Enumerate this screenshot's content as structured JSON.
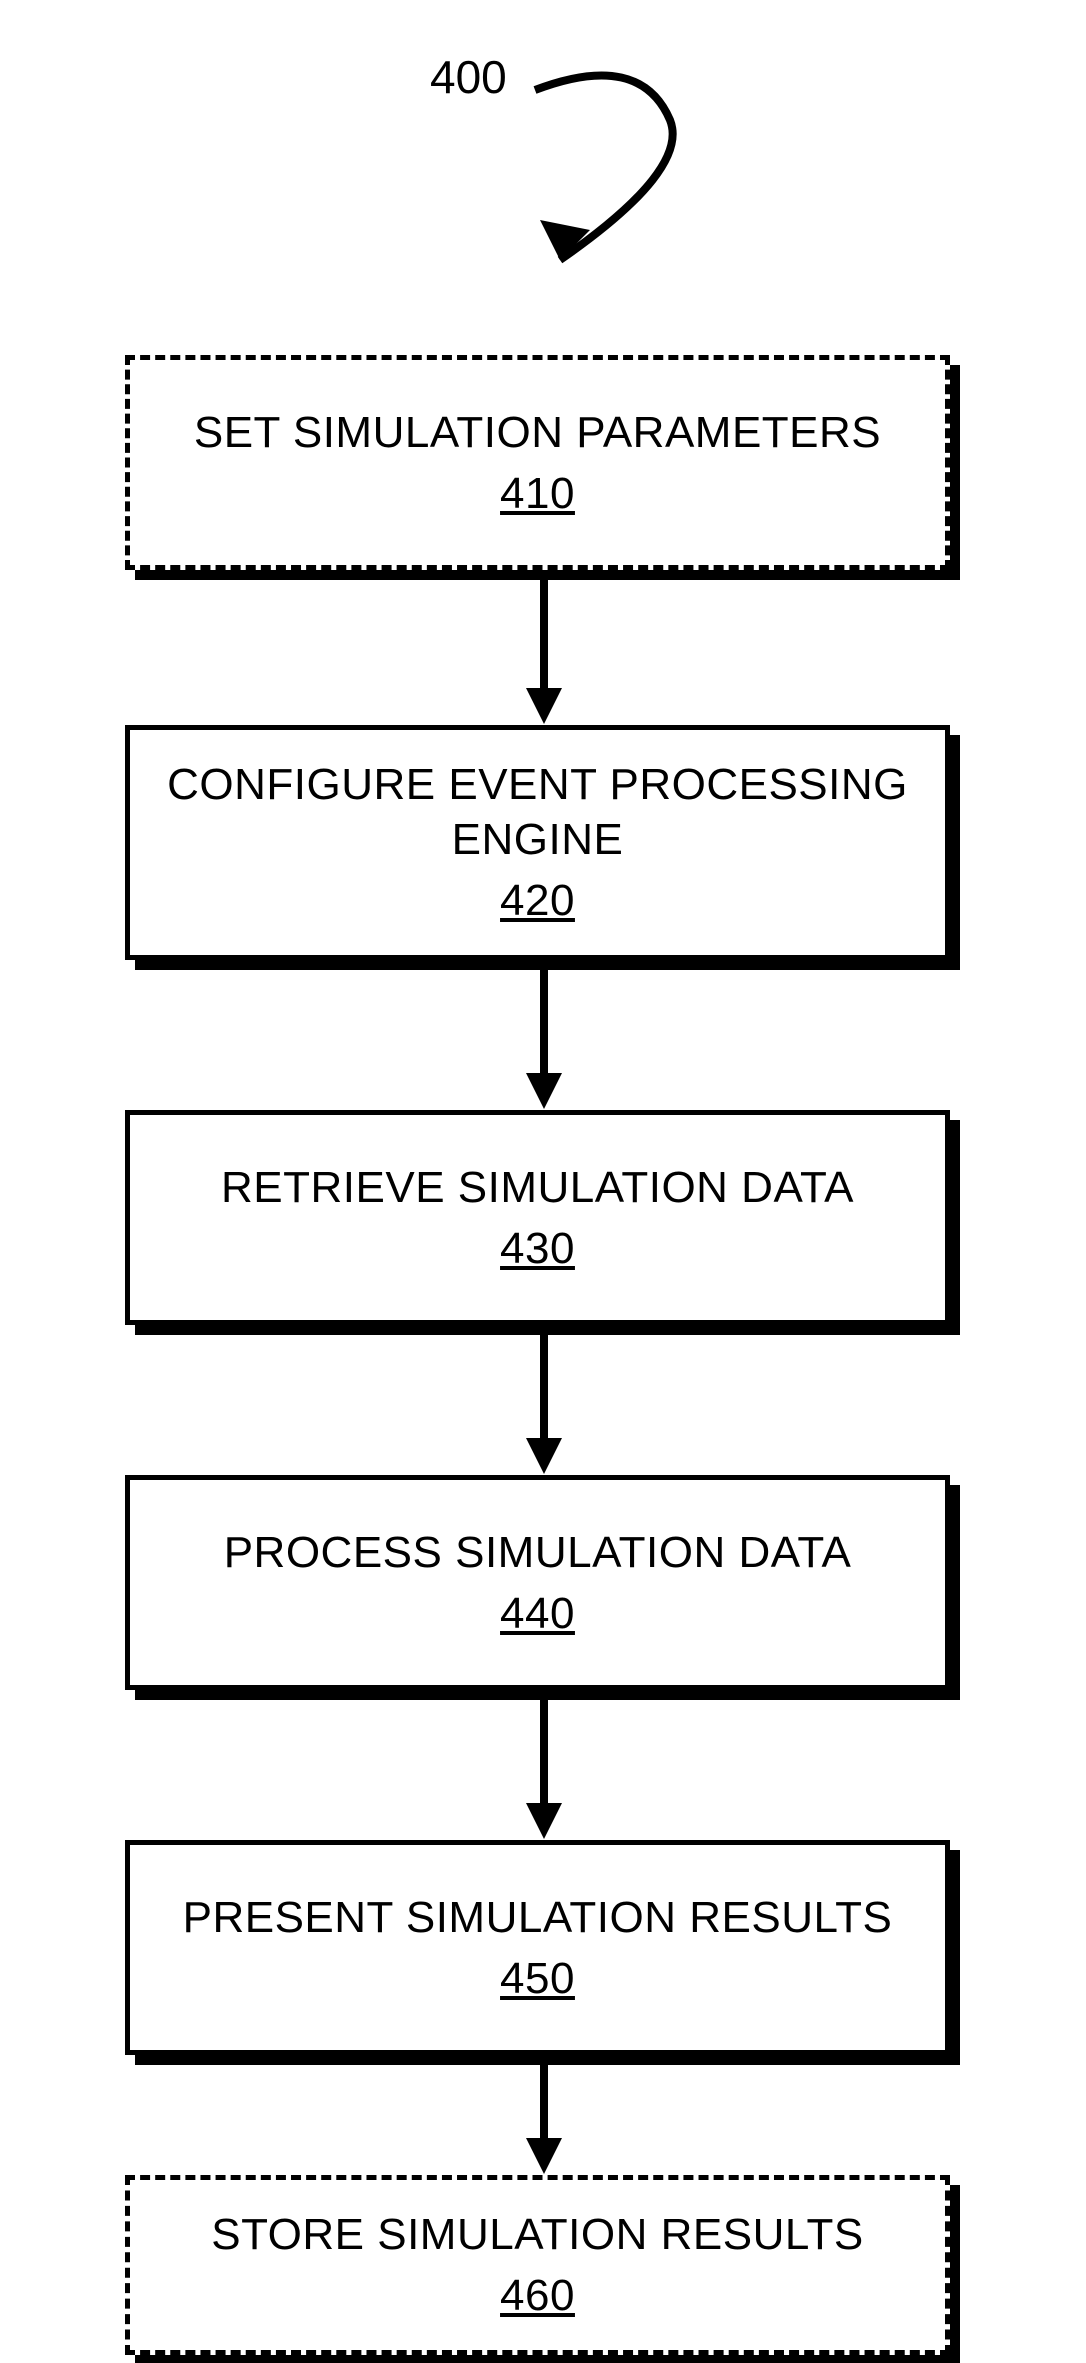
{
  "ref": "400",
  "steps": [
    {
      "title": "SET SIMULATION PARAMETERS",
      "num": "410",
      "style": "dashed"
    },
    {
      "title": "CONFIGURE EVENT PROCESSING ENGINE",
      "num": "420",
      "style": "solid",
      "multiline": true
    },
    {
      "title": "RETRIEVE SIMULATION DATA",
      "num": "430",
      "style": "solid"
    },
    {
      "title": "PROCESS SIMULATION DATA",
      "num": "440",
      "style": "solid"
    },
    {
      "title": "PRESENT SIMULATION RESULTS",
      "num": "450",
      "style": "solid"
    },
    {
      "title": "STORE SIMULATION RESULTS",
      "num": "460",
      "style": "dashed"
    }
  ]
}
